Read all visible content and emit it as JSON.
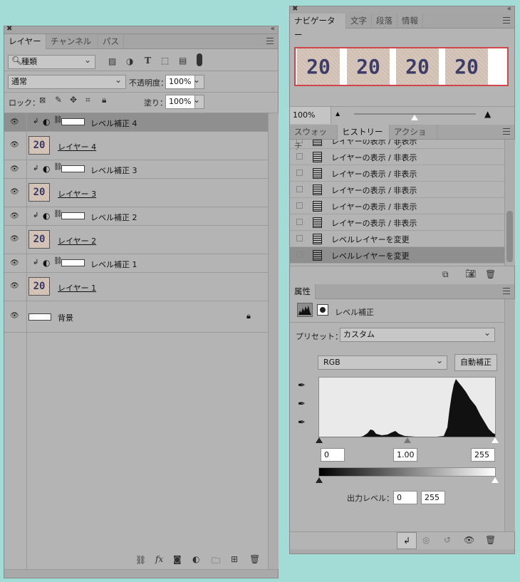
{
  "layers_panel": {
    "tabs": [
      "レイヤー",
      "チャンネル",
      "パス"
    ],
    "filter_kind": "種類",
    "blend_mode": "通常",
    "opacity_label": "不透明度：",
    "opacity_value": "100%",
    "lock_label": "ロック：",
    "fill_label": "塗り：",
    "fill_value": "100%",
    "layers": [
      {
        "name": "レベル補正 4",
        "type": "adjustment",
        "selected": true
      },
      {
        "name": "レイヤー 4",
        "type": "pixel",
        "thumb_text": "20"
      },
      {
        "name": "レベル補正 3",
        "type": "adjustment"
      },
      {
        "name": "レイヤー 3",
        "type": "pixel",
        "thumb_text": "20"
      },
      {
        "name": "レベル補正 2",
        "type": "adjustment"
      },
      {
        "name": "レイヤー 2",
        "type": "pixel",
        "thumb_text": "20"
      },
      {
        "name": "レベル補正 1",
        "type": "adjustment"
      },
      {
        "name": "レイヤー 1",
        "type": "pixel",
        "thumb_text": "20"
      },
      {
        "name": "背景",
        "type": "background",
        "locked": true
      }
    ]
  },
  "navigator_panel": {
    "tabs": [
      "ナビゲーター",
      "文字",
      "段落",
      "情報"
    ],
    "preview_numbers": [
      "20",
      "20",
      "20",
      "20"
    ],
    "zoom": "100%"
  },
  "history_panel": {
    "tabs": [
      "スウォッチ",
      "ヒストリー",
      "アクション"
    ],
    "items": [
      "レイヤーの表示 / 非表示",
      "レイヤーの表示 / 非表示",
      "レイヤーの表示 / 非表示",
      "レイヤーの表示 / 非表示",
      "レイヤーの表示 / 非表示",
      "レイヤーの表示 / 非表示",
      "レベルレイヤーを変更",
      "レベルレイヤーを変更"
    ],
    "selected_index": 7
  },
  "properties_panel": {
    "tab": "属性",
    "title": "レベル補正",
    "preset_label": "プリセット：",
    "preset_value": "カスタム",
    "channel": "RGB",
    "auto_button": "自動補正",
    "input_black": "0",
    "input_gamma": "1.00",
    "input_white": "255",
    "output_label": "出力レベル：",
    "output_black": "0",
    "output_white": "255"
  },
  "colors": {
    "background": "#a3dcd7",
    "panel": "#b4b4b4",
    "selected_row": "#8f8f8f",
    "navigator_frame": "#d0464a"
  }
}
